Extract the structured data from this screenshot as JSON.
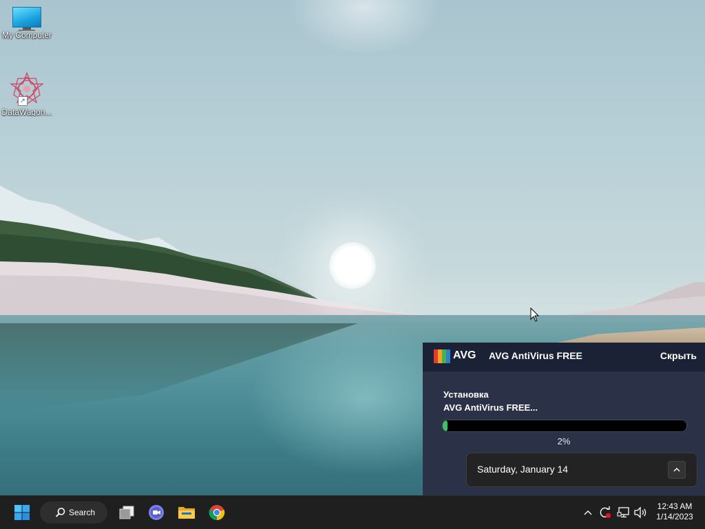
{
  "desktop": {
    "icons": [
      {
        "label": "My Computer",
        "icon": "monitor-icon"
      },
      {
        "label": "DataWagon...",
        "icon": "datawagon-icon"
      }
    ]
  },
  "avg_notification": {
    "logo_text": "AVG",
    "title": "AVG AntiVirus FREE",
    "hide_label": "Скрыть",
    "status_line1": "Установка",
    "status_line2": "AVG AntiVirus FREE...",
    "progress_percent": 2,
    "progress_label": "2%"
  },
  "calendar_flyout": {
    "date_text": "Saturday, January 14",
    "expand_icon": "chevron-up-icon"
  },
  "taskbar": {
    "search_label": "Search",
    "apps": [
      {
        "name": "start",
        "icon": "windows-logo-icon"
      },
      {
        "name": "task-view",
        "icon": "task-view-icon"
      },
      {
        "name": "chat",
        "icon": "teams-chat-icon"
      },
      {
        "name": "file-explorer",
        "icon": "folder-icon"
      },
      {
        "name": "chrome",
        "icon": "chrome-icon"
      }
    ],
    "tray_icons": [
      "chevron-up-icon",
      "sync-alert-icon",
      "network-icon",
      "volume-icon"
    ],
    "clock_time": "12:43 AM",
    "clock_date": "1/14/2023"
  },
  "colors": {
    "avg_panel_bg": "#2b3248",
    "avg_header_bg": "#1c2236",
    "progress_fill": "#3fbf6a",
    "taskbar_bg": "#1f1f1f"
  }
}
